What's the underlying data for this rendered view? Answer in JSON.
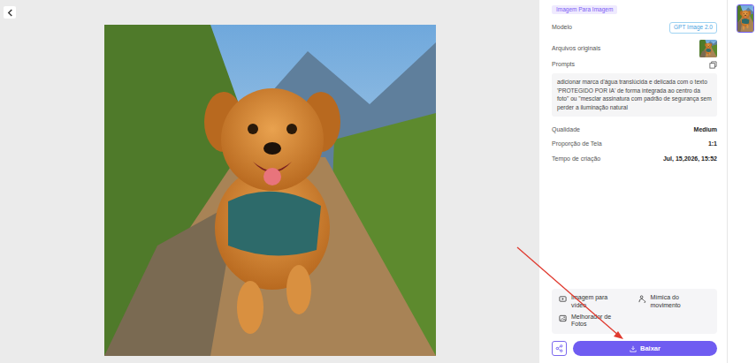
{
  "panel": {
    "badge": "Imagem Para Imagem",
    "model_label": "Modelo",
    "model": "GPT Image 2.0",
    "originals_label": "Arquivos originais",
    "prompts_label": "Prompts",
    "prompt": "adicionar marca d'água translúcida e delicada com o texto 'PROTEGIDO POR IA' de forma integrada ao centro da foto\" ou \"mesclar assinatura com padrão de segurança sem perder a iluminação natural",
    "meta": [
      {
        "label": "Qualidade",
        "value": "Medium"
      },
      {
        "label": "Proporção de Tela",
        "value": "1:1"
      },
      {
        "label": "Tempo de criação",
        "value": "Jul, 15,2026, 15:52"
      }
    ]
  },
  "actions": [
    {
      "label": "Imagem para vídeo",
      "kind": "video"
    },
    {
      "label": "Mímica do movimento",
      "kind": "motion"
    },
    {
      "label": "Melhorador de Fotos",
      "kind": "enhance"
    }
  ],
  "download": {
    "label": "Baixar"
  },
  "history": [
    {
      "selected": true
    }
  ]
}
